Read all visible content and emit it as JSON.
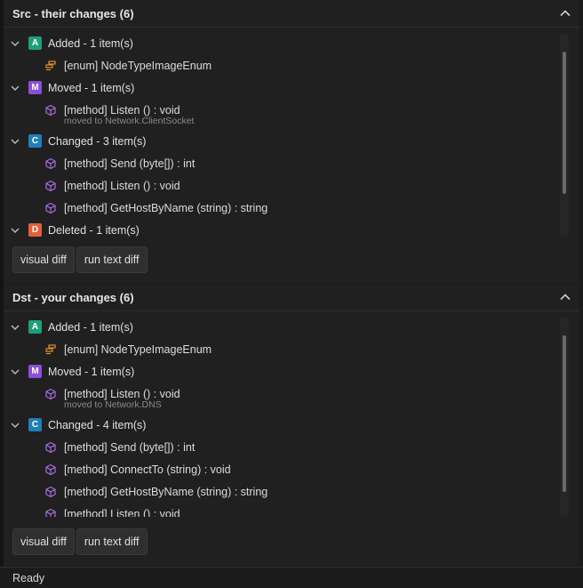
{
  "src_panel": {
    "title": "Src - their changes (6)",
    "groups": [
      {
        "badge": "A",
        "label": "Added - 1 item(s)",
        "items": [
          {
            "text": "[enum] NodeTypeImageEnum"
          }
        ]
      },
      {
        "badge": "M",
        "label": "Moved - 1 item(s)",
        "items": [
          {
            "text": "[method] Listen () : void",
            "sub": "moved to Network.ClientSocket"
          }
        ]
      },
      {
        "badge": "C",
        "label": "Changed - 3 item(s)",
        "items": [
          {
            "text": "[method] Send (byte[]) : int"
          },
          {
            "text": "[method] Listen () : void"
          },
          {
            "text": "[method] GetHostByName (string) : string"
          }
        ]
      },
      {
        "badge": "D",
        "label": "Deleted - 1 item(s)",
        "items": []
      }
    ],
    "buttons": {
      "visual_diff": "visual diff",
      "run_text_diff": "run text diff"
    }
  },
  "dst_panel": {
    "title": "Dst - your changes (6)",
    "groups": [
      {
        "badge": "A",
        "label": "Added - 1 item(s)",
        "items": [
          {
            "text": "[enum] NodeTypeImageEnum"
          }
        ]
      },
      {
        "badge": "M",
        "label": "Moved - 1 item(s)",
        "items": [
          {
            "text": "[method] Listen () : void",
            "sub": "moved to Network.DNS"
          }
        ]
      },
      {
        "badge": "C",
        "label": "Changed - 4 item(s)",
        "items": [
          {
            "text": "[method] Send (byte[]) : int"
          },
          {
            "text": "[method] ConnectTo (string) : void"
          },
          {
            "text": "[method] GetHostByName (string) : string"
          },
          {
            "text": "[method] Listen () : void"
          }
        ]
      }
    ],
    "buttons": {
      "visual_diff": "visual diff",
      "run_text_diff": "run text diff"
    }
  },
  "status": {
    "text": "Ready"
  },
  "colors": {
    "badge_A": "#1f9e7a",
    "badge_M": "#8a4fd6",
    "badge_C": "#1f7fb8",
    "badge_D": "#e0603d",
    "enum_icon": "#e0902a",
    "method_icon": "#a86be0"
  },
  "icons": {
    "collapse": "chevron-up-icon",
    "group_toggle": "chevron-down-icon",
    "enum": "enum-icon",
    "method": "method-cube-icon"
  }
}
